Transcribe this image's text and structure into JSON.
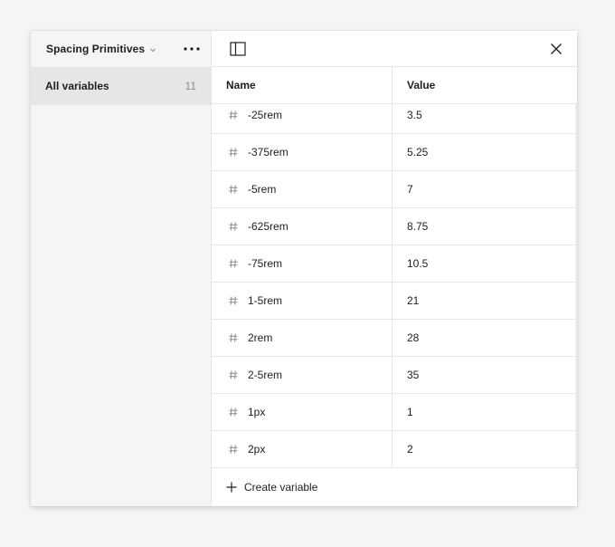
{
  "sidebar": {
    "collection_name": "Spacing Primitives",
    "items": [
      {
        "label": "All variables",
        "count": "11"
      }
    ]
  },
  "table": {
    "headers": {
      "name": "Name",
      "value": "Value"
    },
    "rows": [
      {
        "name": "-25rem",
        "value": "3.5"
      },
      {
        "name": "-375rem",
        "value": "5.25"
      },
      {
        "name": "-5rem",
        "value": "7"
      },
      {
        "name": "-625rem",
        "value": "8.75"
      },
      {
        "name": "-75rem",
        "value": "10.5"
      },
      {
        "name": "1-5rem",
        "value": "21"
      },
      {
        "name": "2rem",
        "value": "28"
      },
      {
        "name": "2-5rem",
        "value": "35"
      },
      {
        "name": "1px",
        "value": "1"
      },
      {
        "name": "2px",
        "value": "2"
      }
    ]
  },
  "footer": {
    "create_label": "Create variable"
  },
  "icons": {
    "collection_dropdown": "chevron-down-icon",
    "more": "more-horizontal-icon",
    "sidebar_toggle": "sidebar-toggle-icon",
    "close": "close-icon",
    "variable_type": "hash-icon",
    "create": "plus-icon"
  },
  "colors": {
    "background": "#f5f5f5",
    "panel": "#ffffff",
    "selected_item": "#e6e6e6",
    "border": "#e6e6e6",
    "muted_text": "#8c8c8c"
  }
}
